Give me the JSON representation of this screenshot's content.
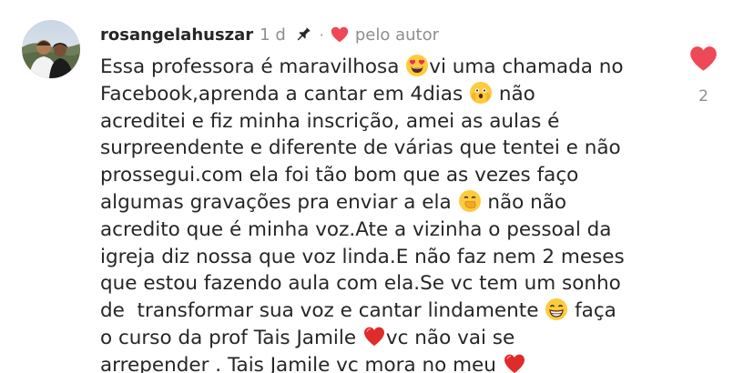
{
  "comment": {
    "username": "rosangelahuszar",
    "time": "1 d",
    "separator": "·",
    "by_author_label": "pelo autor",
    "like_count": "2",
    "accent_color": "#ed4956",
    "icons": {
      "pin": "pin-icon",
      "author_heart": "heart-icon",
      "like": "heart-icon"
    },
    "lines": [
      {
        "segments": [
          {
            "t": "Essa professora é maravilhosa "
          },
          {
            "emoji": "heart-eyes-emoji"
          },
          {
            "t": "vi uma chamada no"
          }
        ]
      },
      {
        "segments": [
          {
            "t": "Facebook,aprenda a cantar em 4dias "
          },
          {
            "emoji": "shocked-face-emoji"
          },
          {
            "t": " não"
          }
        ]
      },
      {
        "segments": [
          {
            "t": "acreditei e fiz minha inscrição, amei as aulas é"
          }
        ]
      },
      {
        "segments": [
          {
            "t": "surpreendente e diferente de várias que tentei e não"
          }
        ]
      },
      {
        "segments": [
          {
            "t": "prossegui.com ela foi tão bom que as vezes faço"
          }
        ]
      },
      {
        "segments": [
          {
            "t": "algumas gravações pra enviar a ela "
          },
          {
            "emoji": "hand-over-mouth-emoji"
          },
          {
            "t": " não não"
          }
        ]
      },
      {
        "segments": [
          {
            "t": "acredito que é minha voz.Ate a vizinha o pessoal da"
          }
        ]
      },
      {
        "segments": [
          {
            "t": "igreja diz nossa que voz linda.E não faz nem 2 meses"
          }
        ]
      },
      {
        "segments": [
          {
            "t": "que estou fazendo aula com ela.Se vc tem um sonho"
          }
        ]
      },
      {
        "segments": [
          {
            "t": "de  transformar sua voz e cantar lindamente "
          },
          {
            "emoji": "grinning-face-emoji"
          },
          {
            "t": " faça"
          }
        ]
      },
      {
        "segments": [
          {
            "t": "o curso da prof Tais Jamile "
          },
          {
            "emoji": "red-heart-emoji"
          },
          {
            "t": "vc não vai se"
          }
        ]
      },
      {
        "segments": [
          {
            "t": "arrepender . Tais Jamile vc mora no meu "
          },
          {
            "emoji": "red-heart-emoji"
          }
        ]
      }
    ]
  }
}
